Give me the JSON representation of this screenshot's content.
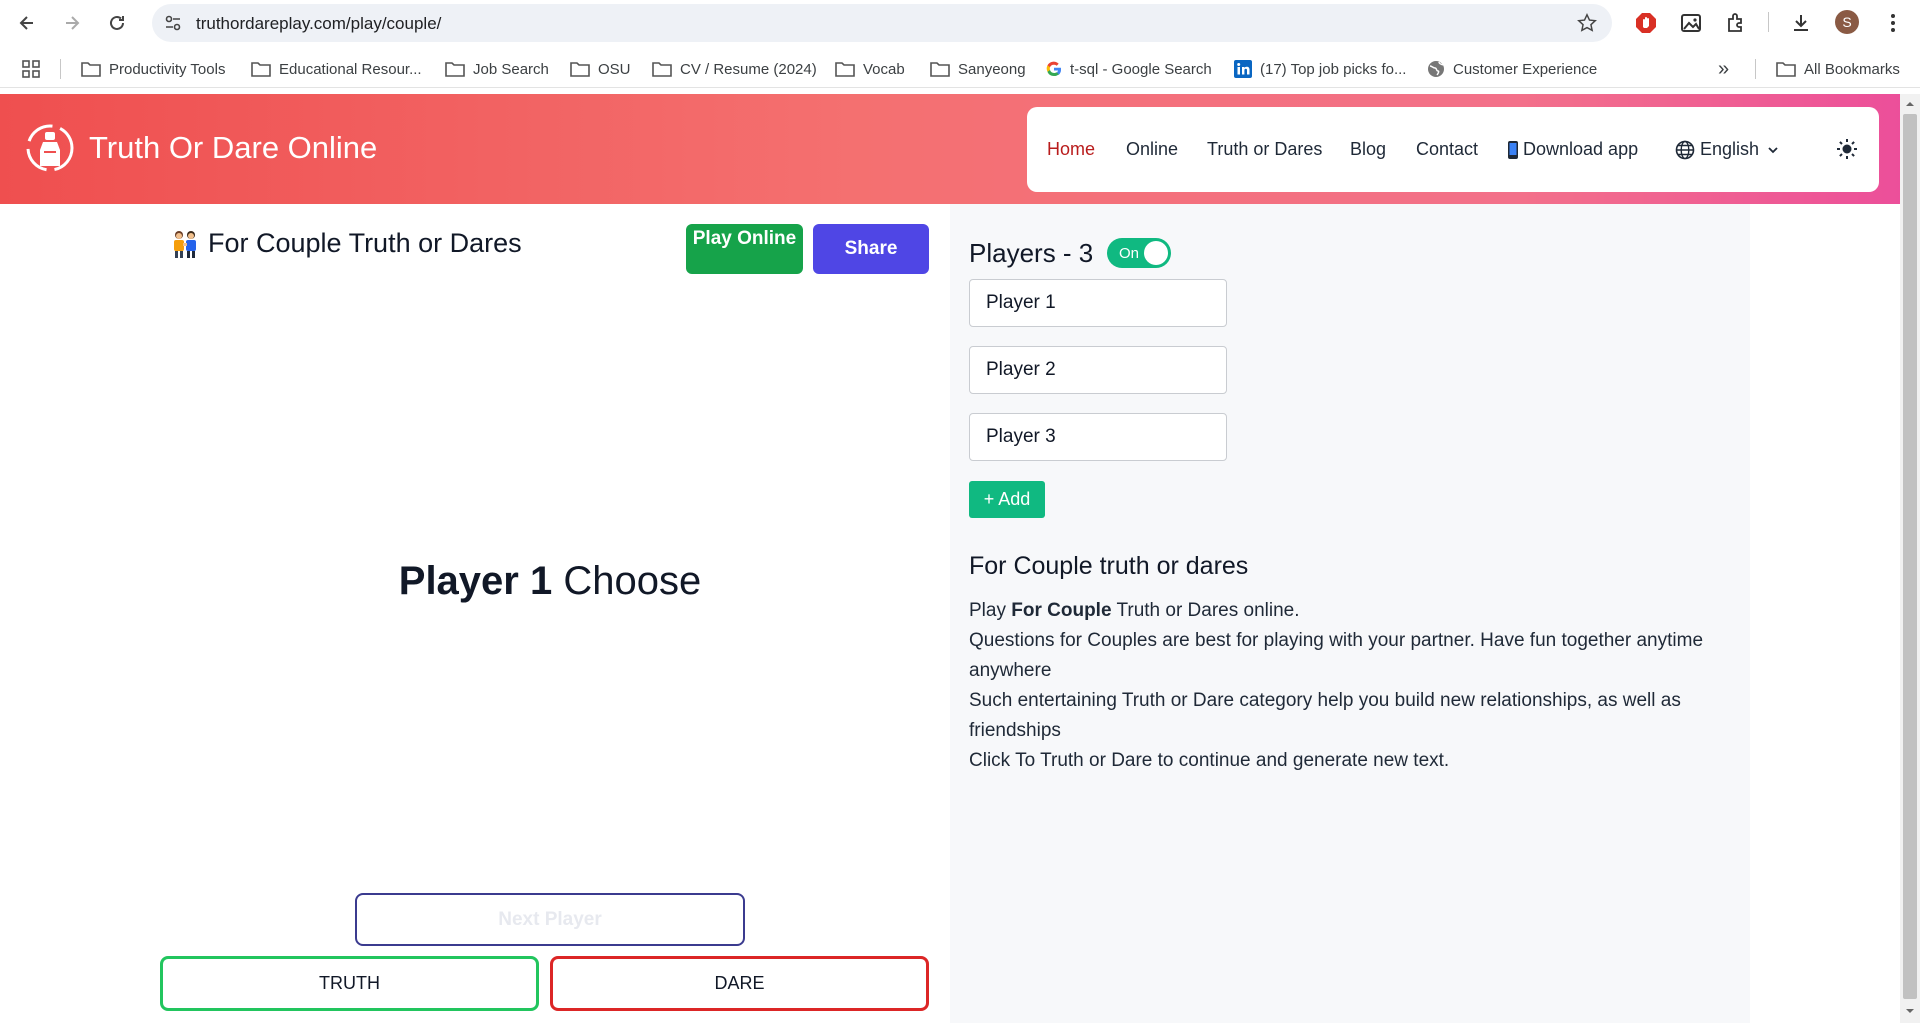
{
  "browser": {
    "url": "truthordareplay.com/play/couple/",
    "avatar_letter": "S"
  },
  "bookmarks": {
    "items": [
      {
        "label": "Productivity Tools",
        "icon": "folder-icon"
      },
      {
        "label": "Educational Resour...",
        "icon": "folder-icon"
      },
      {
        "label": "Job Search",
        "icon": "folder-icon"
      },
      {
        "label": "OSU",
        "icon": "folder-icon"
      },
      {
        "label": "CV / Resume (2024)",
        "icon": "folder-icon"
      },
      {
        "label": "Vocab",
        "icon": "folder-icon"
      },
      {
        "label": "Sanyeong",
        "icon": "folder-icon"
      },
      {
        "label": "t-sql - Google Search",
        "icon": "google-icon"
      },
      {
        "label": "(17) Top job picks fo...",
        "icon": "linkedin-icon"
      },
      {
        "label": "Customer Experience",
        "icon": "globe-icon"
      }
    ],
    "overflow_label": "»",
    "all_bookmarks_label": "All Bookmarks"
  },
  "header": {
    "title": "Truth Or Dare Online",
    "nav": {
      "home": "Home",
      "online": "Online",
      "truth_or_dares": "Truth or Dares",
      "blog": "Blog",
      "contact": "Contact",
      "download": "Download app",
      "language": "English"
    },
    "active_color": "#b91c1c",
    "gradient": [
      "#ef4f4f",
      "#ec4f9a"
    ]
  },
  "game": {
    "category_title": "For Couple Truth or Dares",
    "play_online": "Play Online",
    "share": "Share",
    "current_player": "Player 1",
    "choose": "Choose",
    "next_player": "Next Player",
    "truth": "TRUTH",
    "dare": "DARE"
  },
  "players": {
    "title": "Players - 3",
    "toggle_label": "On",
    "toggle_on": true,
    "values": [
      "Player 1",
      "Player 2",
      "Player 3"
    ],
    "add_label": "+ Add"
  },
  "description": {
    "title": "For Couple truth or dares",
    "line1_pre": "Play ",
    "line1_bold": "For Couple",
    "line1_post": " Truth or Dares online.",
    "line2": "Questions for Couples are best for playing with your partner. Have fun together anytime anywhere",
    "line3": "Such entertaining Truth or Dare category help you build new relationships, as well as friendships",
    "line4": "Click To Truth or Dare to continue and generate new text."
  }
}
